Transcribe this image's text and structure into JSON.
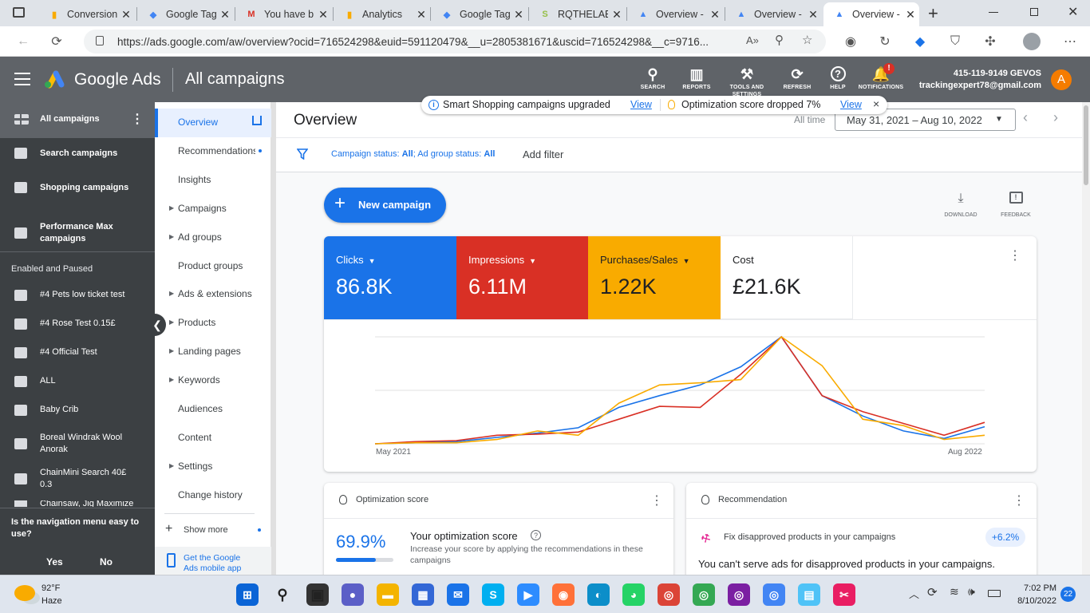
{
  "browser": {
    "tabs": [
      {
        "title": "Conversion",
        "icon": "analytics-icon"
      },
      {
        "title": "Google Tag",
        "icon": "tag-manager-icon"
      },
      {
        "title": "You have b",
        "icon": "gmail-icon"
      },
      {
        "title": "Analytics",
        "icon": "analytics-icon"
      },
      {
        "title": "Google Tag",
        "icon": "tag-manager-icon"
      },
      {
        "title": "RQTHELAB",
        "icon": "shopify-icon"
      },
      {
        "title": "Overview -",
        "icon": "google-ads-icon"
      },
      {
        "title": "Overview -",
        "icon": "google-ads-icon"
      },
      {
        "title": "Overview -",
        "icon": "google-ads-icon"
      }
    ],
    "active_tab": 8,
    "url": "https://ads.google.com/aw/overview?ocid=716524298&euid=591120479&__u=2805381671&uscid=716524298&__c=9716..."
  },
  "header": {
    "brand": "Google Ads",
    "section": "All campaigns",
    "icons": [
      {
        "label": "SEARCH",
        "icon": "search-icon"
      },
      {
        "label": "REPORTS",
        "icon": "reports-icon"
      },
      {
        "label": "TOOLS AND SETTINGS",
        "icon": "wrench-icon"
      },
      {
        "label": "REFRESH",
        "icon": "refresh-icon"
      },
      {
        "label": "HELP",
        "icon": "help-icon"
      },
      {
        "label": "NOTIFICATIONS",
        "icon": "bell-icon"
      }
    ],
    "account_id": "415-119-9149 GEVOS",
    "email": "trackingexpert78@gmail.com",
    "avatar_letter": "A",
    "notification_badge": "!"
  },
  "notice": {
    "smart_text": "Smart Shopping campaigns upgraded",
    "smart_link": "View",
    "opt_text": "Optimization score dropped 7%",
    "opt_link": "View",
    "close": "×"
  },
  "leftnav": {
    "top_items": [
      {
        "label": "All campaigns"
      },
      {
        "label": "Search campaigns"
      },
      {
        "label": "Shopping campaigns"
      },
      {
        "label": "Performance Max campaigns"
      }
    ],
    "group_label": "Enabled and Paused",
    "campaigns": [
      "#4 Pets low ticket test",
      "#4 Rose Test 0.15£",
      "#4 Official Test",
      "ALL",
      "Baby Crib",
      "Boreal Windrak Wool Anorak",
      "ChainMini Search 40£ 0.3",
      "Chainsaw, Jig Maximize"
    ],
    "feedback_q": "Is the navigation menu easy to use?",
    "yes": "Yes",
    "no": "No"
  },
  "subnav": {
    "items": [
      {
        "label": "Overview",
        "arrow": false
      },
      {
        "label": "Recommendations",
        "arrow": false
      },
      {
        "label": "Insights",
        "arrow": false
      },
      {
        "label": "Campaigns",
        "arrow": true
      },
      {
        "label": "Ad groups",
        "arrow": true
      },
      {
        "label": "Product groups",
        "arrow": false
      },
      {
        "label": "Ads & extensions",
        "arrow": true
      },
      {
        "label": "Products",
        "arrow": true
      },
      {
        "label": "Landing pages",
        "arrow": true
      },
      {
        "label": "Keywords",
        "arrow": true
      },
      {
        "label": "Audiences",
        "arrow": false
      },
      {
        "label": "Content",
        "arrow": false
      },
      {
        "label": "Settings",
        "arrow": true
      },
      {
        "label": "Change history",
        "arrow": false
      }
    ],
    "show_more": "Show more",
    "mobile_app": "Get the Google Ads mobile app"
  },
  "main": {
    "title": "Overview",
    "all_time": "All time",
    "date_range": "May 31, 2021 – Aug 10, 2022",
    "filter_text": "Campaign status: All; Ad group status: All",
    "filter_key1": "Campaign status: ",
    "filter_val1": "All",
    "filter_key2": "; Ad group status: ",
    "filter_val2": "All",
    "add_filter": "Add filter",
    "new_campaign": "New campaign",
    "download": "DOWNLOAD",
    "feedback": "FEEDBACK"
  },
  "metrics": [
    {
      "label": "Clicks",
      "value": "86.8K",
      "color": "#1a73e8",
      "dropdown": true
    },
    {
      "label": "Impressions",
      "value": "6.11M",
      "color": "#d93025",
      "dropdown": true
    },
    {
      "label": "Purchases/Sales",
      "value": "1.22K",
      "color": "#f9ab00",
      "dropdown": true
    },
    {
      "label": "Cost",
      "value": "£21.6K",
      "color": "#ffffff",
      "dropdown": false
    }
  ],
  "chart_data": {
    "type": "line",
    "x_start_label": "May 2021",
    "x_end_label": "Aug 2022",
    "series": [
      {
        "color": "#1a73e8",
        "values": [
          0.0,
          0.01,
          0.02,
          0.06,
          0.1,
          0.15,
          0.34,
          0.45,
          0.55,
          0.72,
          1.0,
          0.45,
          0.26,
          0.12,
          0.05,
          0.16
        ]
      },
      {
        "color": "#d93025",
        "values": [
          0.0,
          0.02,
          0.03,
          0.08,
          0.09,
          0.11,
          0.23,
          0.35,
          0.34,
          0.65,
          1.0,
          0.45,
          0.3,
          0.19,
          0.08,
          0.2
        ]
      },
      {
        "color": "#f9ab00",
        "values": [
          0.0,
          0.01,
          0.01,
          0.04,
          0.12,
          0.08,
          0.38,
          0.55,
          0.57,
          0.6,
          1.0,
          0.73,
          0.23,
          0.17,
          0.04,
          0.08
        ]
      }
    ]
  },
  "optimization": {
    "title": "Optimization score",
    "score": "69.9%",
    "score_fraction": 0.699,
    "heading": "Your optimization score",
    "desc": "Increase your score by applying the recommendations in these campaigns"
  },
  "recommendation": {
    "title": "Recommendation",
    "item": "Fix disapproved products in your campaigns",
    "uplift": "+6.2%",
    "body": "You can't serve ads for disapproved products in your campaigns."
  },
  "taskbar": {
    "temp": "92°F",
    "weather": "Haze",
    "time": "7:02 PM",
    "date": "8/10/2022",
    "notif_count": "22"
  }
}
